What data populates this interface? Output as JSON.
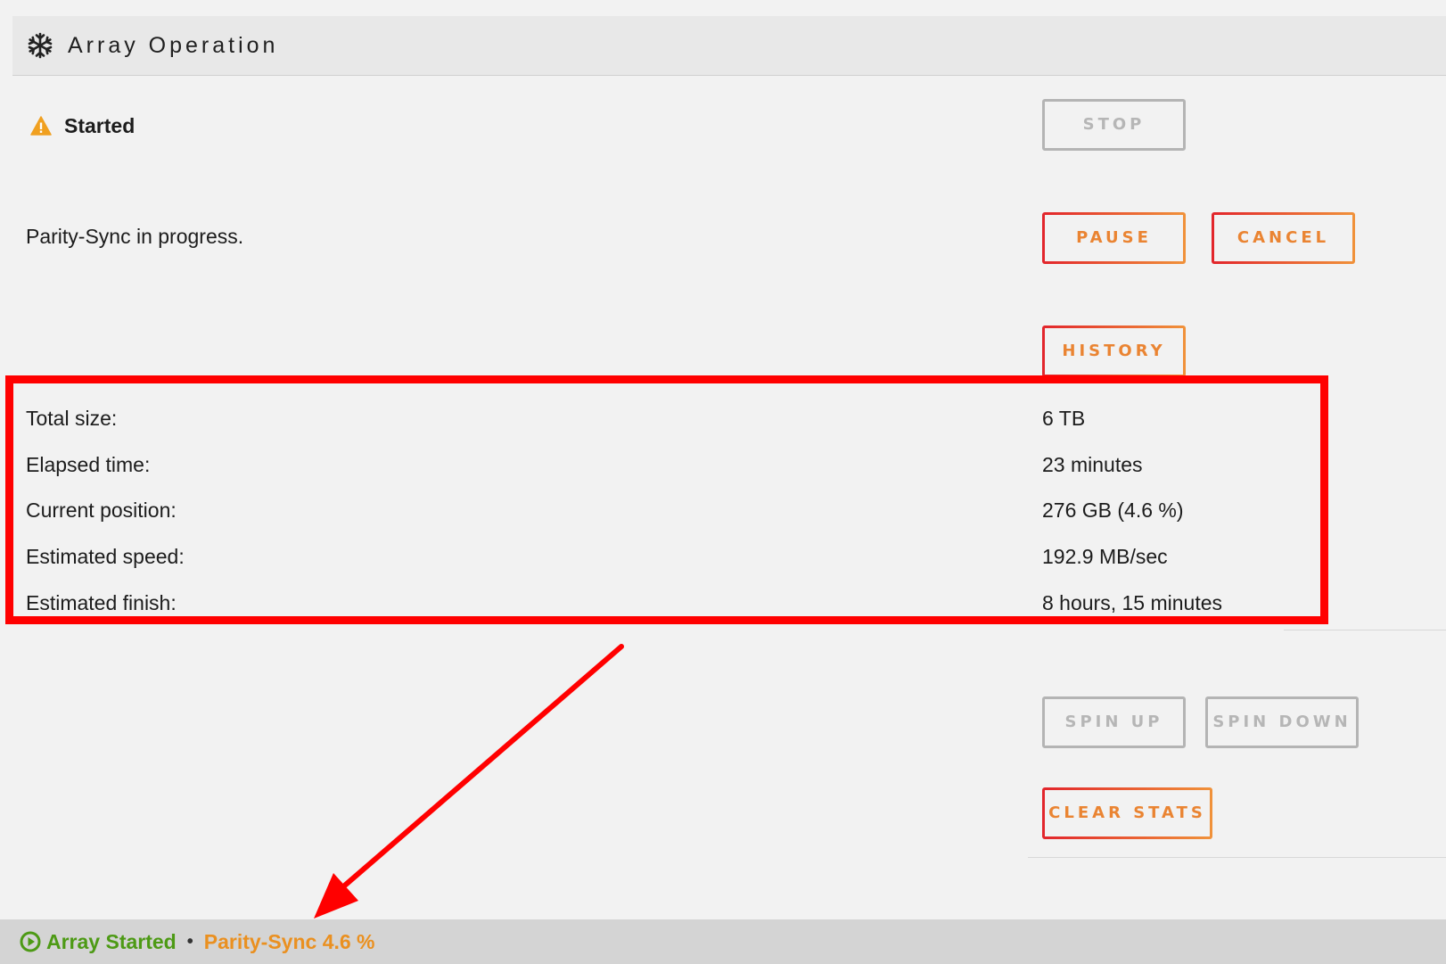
{
  "header": {
    "title": "Array Operation",
    "icon": "snowflake-icon"
  },
  "status": {
    "state": "Started",
    "icon": "warning-icon",
    "message": "Parity-Sync in progress."
  },
  "buttons": {
    "stop": "STOP",
    "pause": "PAUSE",
    "cancel": "CANCEL",
    "history": "HISTORY",
    "spin_up": "SPIN UP",
    "spin_down": "SPIN DOWN",
    "clear_stats": "CLEAR STATS"
  },
  "stats": [
    {
      "label": "Total size:",
      "value": "6 TB"
    },
    {
      "label": "Elapsed time:",
      "value": "23 minutes"
    },
    {
      "label": "Current position:",
      "value": "276 GB (4.6 %)"
    },
    {
      "label": "Estimated speed:",
      "value": "192.9 MB/sec"
    },
    {
      "label": "Estimated finish:",
      "value": "8 hours, 15 minutes"
    }
  ],
  "footer": {
    "array_status": "Array Started",
    "separator": "•",
    "parity_status": "Parity-Sync 4.6 %"
  },
  "colors": {
    "accent_orange": "#ea8432",
    "accent_red": "#e2252c",
    "disabled_gray": "#b4b4b4",
    "footer_green": "#4d9a15",
    "footer_orange": "#ea9020",
    "annotation_red": "#ff0000"
  }
}
